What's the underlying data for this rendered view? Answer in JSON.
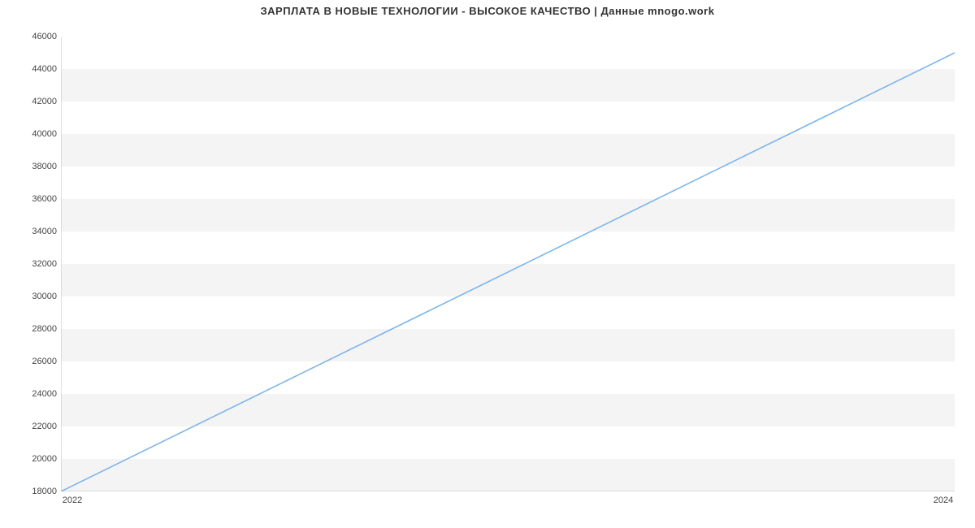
{
  "chart_data": {
    "type": "line",
    "title": "ЗАРПЛАТА В НОВЫЕ ТЕХНОЛОГИИ - ВЫСОКОЕ КАЧЕСТВО | Данные mnogo.work",
    "x": [
      2022,
      2024
    ],
    "values": [
      18000,
      45000
    ],
    "x_ticks": [
      2022,
      2024
    ],
    "y_ticks": [
      18000,
      20000,
      22000,
      24000,
      26000,
      28000,
      30000,
      32000,
      34000,
      36000,
      38000,
      40000,
      42000,
      44000,
      46000
    ],
    "xlim": [
      2022,
      2024
    ],
    "ylim": [
      18000,
      46000
    ],
    "xlabel": "",
    "ylabel": "",
    "line_color": "#7cb5ec",
    "grid_band_color": "#f4f4f4"
  }
}
